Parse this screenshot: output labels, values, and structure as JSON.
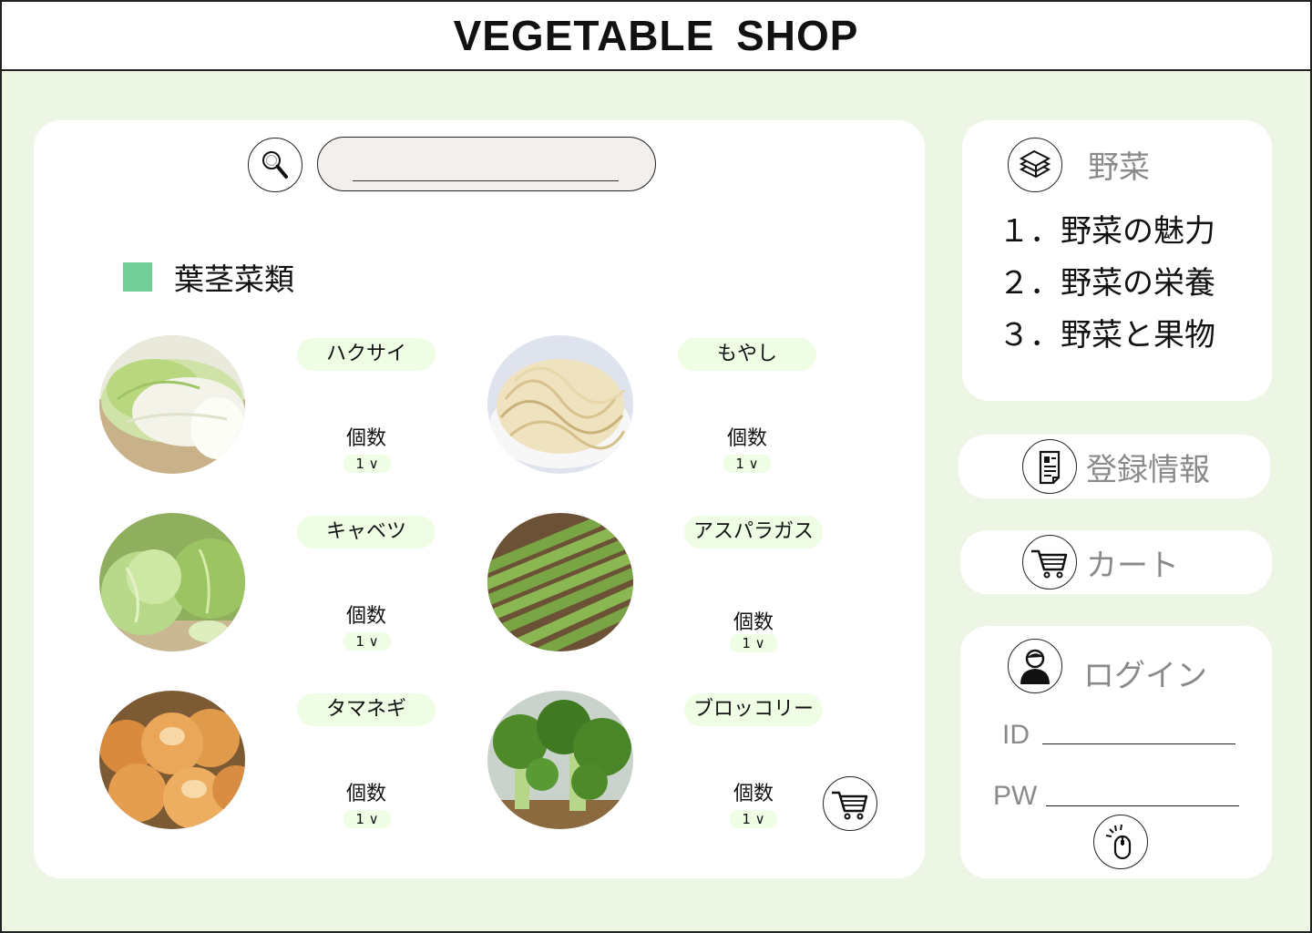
{
  "header": {
    "title": "VEGETABLE  SHOP"
  },
  "search": {
    "value": "",
    "placeholder": ""
  },
  "category": {
    "title": "葉茎菜類",
    "marker_color": "#72cf98"
  },
  "products": [
    {
      "name": "ハクサイ",
      "qty_label": "個数",
      "qty": "1 ∨"
    },
    {
      "name": "もやし",
      "qty_label": "個数",
      "qty": "1 ∨"
    },
    {
      "name": "キャベツ",
      "qty_label": "個数",
      "qty": "1 ∨"
    },
    {
      "name": "アスパラガス",
      "qty_label": "個数",
      "qty": "1 ∨"
    },
    {
      "name": "タマネギ",
      "qty_label": "個数",
      "qty": "1 ∨"
    },
    {
      "name": "ブロッコリー",
      "qty_label": "個数",
      "qty": "1 ∨"
    }
  ],
  "sidebar": {
    "vegetables": {
      "title": "野菜",
      "icon": "book-icon",
      "items": [
        "１．野菜の魅力",
        "２．野菜の栄養",
        "３．野菜と果物"
      ]
    },
    "registration": {
      "label": "登録情報",
      "icon": "document-icon"
    },
    "cart": {
      "label": "カート",
      "icon": "cart-icon"
    },
    "login": {
      "title": "ログイン",
      "icon": "user-icon",
      "id_label": "ID",
      "pw_label": "PW",
      "submit_icon": "mouse-click-icon"
    }
  },
  "colors": {
    "background": "#edf5e5",
    "panel": "#ffffff",
    "tag": "#eefde4",
    "muted_text": "#8a8a8a",
    "search_fill": "#f2efed"
  }
}
